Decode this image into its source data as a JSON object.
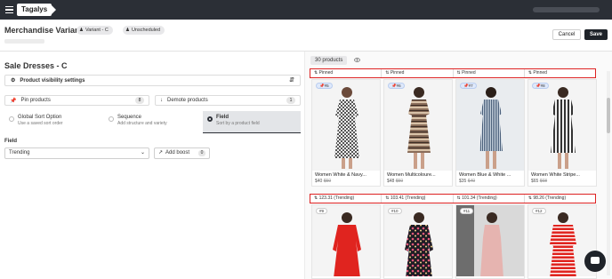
{
  "app": {
    "logo": "Tagalys"
  },
  "header": {
    "title": "Merchandise Variant",
    "badges": [
      {
        "label": "Variant - C"
      },
      {
        "label": "Unscheduled"
      }
    ],
    "cancel_label": "Cancel",
    "save_label": "Save"
  },
  "left": {
    "section_title": "Sale Dresses - C",
    "visibility_settings": "Product visibility settings",
    "pin_products": {
      "label": "Pin products",
      "count": "8"
    },
    "demote_products": {
      "label": "Demote products",
      "count": "1"
    },
    "sort_options": [
      {
        "title": "Global Sort Option",
        "desc": "Use a saved sort order"
      },
      {
        "title": "Sequence",
        "desc": "Add structure and variety"
      },
      {
        "title": "Field",
        "desc": "Sort by a product field"
      }
    ],
    "field_label": "Field",
    "field_value": "Trending",
    "add_boost": {
      "label": "Add boost",
      "count": "0"
    }
  },
  "right": {
    "product_count": "30 products",
    "row1_labels": [
      "Pinned",
      "Pinned",
      "Pinned",
      "Pinned"
    ],
    "row2_labels": [
      "123.31 (Trending)",
      "103.41 (Trending)",
      "101.34 (Trending)",
      "98.26 (Trending)"
    ],
    "row1_products": [
      {
        "tag": "#5",
        "name": "Women White & Navy...",
        "price": "$40",
        "old": "$50"
      },
      {
        "tag": "#6",
        "name": "Women Multicoloure...",
        "price": "$48",
        "old": "$50"
      },
      {
        "tag": "#7",
        "name": "Women Blue & White ...",
        "price": "$35",
        "old": "$40"
      },
      {
        "tag": "#8",
        "name": "Women White Stripe...",
        "price": "$65",
        "old": "$68"
      }
    ],
    "row2_tags": [
      "#9",
      "#10",
      "#11",
      "#12"
    ]
  }
}
